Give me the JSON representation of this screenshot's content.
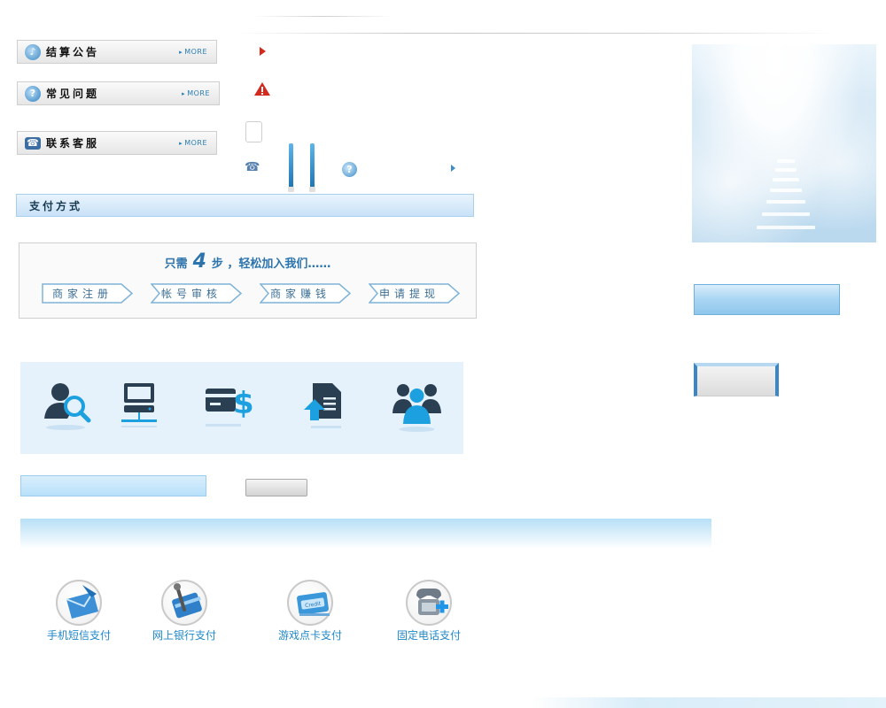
{
  "sidebar": {
    "settlement": {
      "title": "结算公告",
      "more": "MORE"
    },
    "faq": {
      "title": "常见问题",
      "more": "MORE"
    },
    "contact": {
      "title": "联系客服",
      "more": "MORE"
    }
  },
  "payment_section": {
    "title": "支付方式"
  },
  "steps": {
    "prefix": "只需",
    "count": "4",
    "suffix": "步 ，轻松加入我们……",
    "items": [
      "商家注册",
      "帐号审核",
      "商家赚钱",
      "申请提现"
    ]
  },
  "payment_methods": [
    {
      "label": "手机短信支付",
      "icon": "sms-envelope-icon"
    },
    {
      "label": "网上银行支付",
      "icon": "bank-card-icon"
    },
    {
      "label": "游戏点卡支付",
      "icon": "game-card-icon"
    },
    {
      "label": "固定电话支付",
      "icon": "telephone-icon"
    }
  ],
  "colors": {
    "accent_blue": "#2d74ac",
    "link_blue": "#1f88c8",
    "icon_navy": "#2b3f52",
    "icon_cyan": "#1da0e0"
  }
}
